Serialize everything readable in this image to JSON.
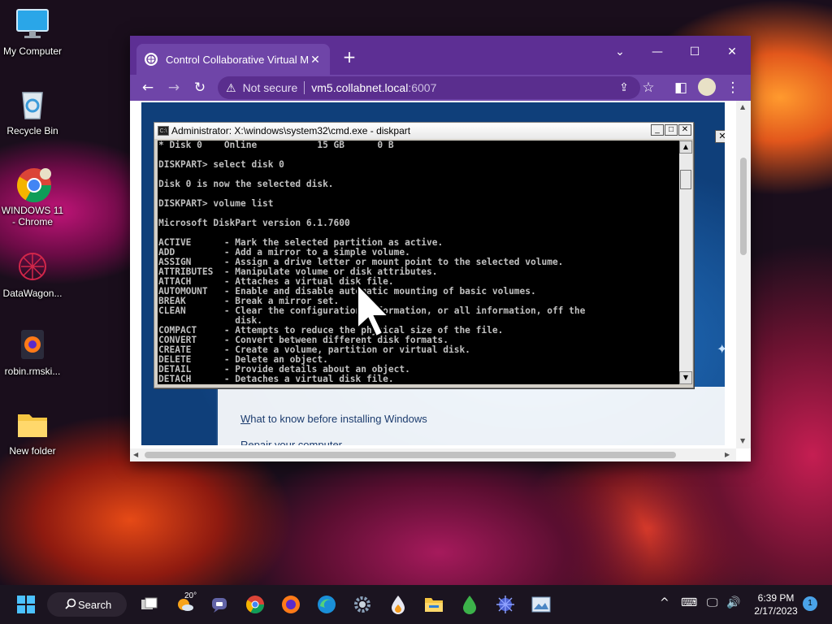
{
  "desktop": {
    "icons": [
      {
        "label": "My Computer"
      },
      {
        "label": "Recycle Bin"
      },
      {
        "label": "WINDOWS 11 - Chrome"
      },
      {
        "label": "DataWagon..."
      },
      {
        "label": "robin.rmski..."
      },
      {
        "label": "New folder"
      }
    ]
  },
  "browser": {
    "tab_title": "Control Collaborative Virtual Mac",
    "tab_close": "✕",
    "new_tab": "+",
    "window_controls": {
      "chevron": "⌄",
      "minimize": "—",
      "maximize": "☐",
      "close": "✕"
    },
    "nav": {
      "back": "←",
      "forward": "→",
      "reload": "↻"
    },
    "omnibox": {
      "warning_icon": "⚠",
      "not_secure": "Not secure",
      "host": "vm5.collabnet.local",
      "port": ":6007"
    },
    "toolbar_icons": {
      "share": "⇪",
      "star": "☆",
      "sidepanel": "◧",
      "menu": "⋮"
    }
  },
  "setup": {
    "link1_first": "W",
    "link1_rest": "hat to know before installing Windows",
    "link2_first": "R",
    "link2_rest": "epair your computer",
    "close": "✕"
  },
  "cmd": {
    "title": "Administrator: X:\\windows\\system32\\cmd.exe - diskpart",
    "icon_text": "C:\\",
    "buttons": {
      "minimize": "_",
      "maximize": "□",
      "close": "✕"
    },
    "lines": [
      "* Disk 0    Online           15 GB      0 B",
      "",
      "DISKPART> select disk 0",
      "",
      "Disk 0 is now the selected disk.",
      "",
      "DISKPART> volume list",
      "",
      "Microsoft DiskPart version 6.1.7600",
      "",
      "ACTIVE      - Mark the selected partition as active.",
      "ADD         - Add a mirror to a simple volume.",
      "ASSIGN      - Assign a drive letter or mount point to the selected volume.",
      "ATTRIBUTES  - Manipulate volume or disk attributes.",
      "ATTACH      - Attaches a virtual disk file.",
      "AUTOMOUNT   - Enable and disable automatic mounting of basic volumes.",
      "BREAK       - Break a mirror set.",
      "CLEAN       - Clear the configuration information, or all information, off the",
      "              disk.",
      "COMPACT     - Attempts to reduce the physical size of the file.",
      "CONVERT     - Convert between different disk formats.",
      "CREATE      - Create a volume, partition or virtual disk.",
      "DELETE      - Delete an object.",
      "DETAIL      - Provide details about an object.",
      "DETACH      - Detaches a virtual disk file."
    ]
  },
  "taskbar": {
    "search_label": "Search",
    "weather_temp": "20°",
    "clock_time": "6:39 PM",
    "clock_date": "2/17/2023",
    "notification_count": "1",
    "tray": {
      "chevron": "^",
      "keyboard": "⌨",
      "network": "🖵",
      "volume": "🔊"
    }
  },
  "colors": {
    "browser_frame": "#6b3fa0",
    "cmd_background": "#000000",
    "cmd_text": "#c0c0c0",
    "taskbar": "#1b1420"
  }
}
